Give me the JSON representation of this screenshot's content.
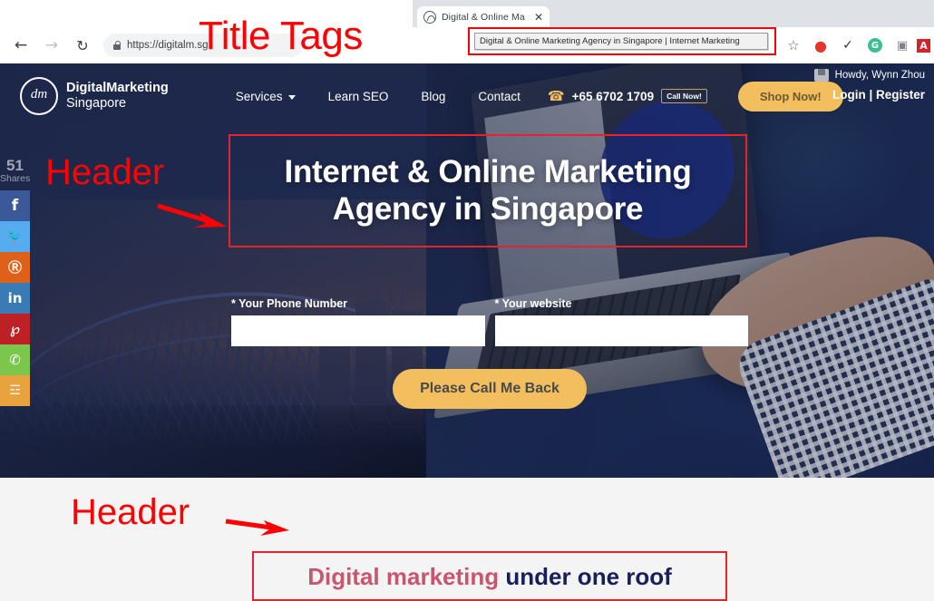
{
  "browser": {
    "tab": {
      "title": "Digital & Online Ma",
      "close_label": "✕",
      "favicon": "site-favicon"
    },
    "back_label": "←",
    "forward_label": "→",
    "reload_label": "↻",
    "url": "https://digitalm.sg",
    "title_tooltip": "Digital & Online Marketing Agency in Singapore | Internet Marketing",
    "toolbar_icons": [
      {
        "name": "bookmark-star-icon",
        "glyph": "☆",
        "color": "#5f6368"
      },
      {
        "name": "opera-extension-icon",
        "glyph": "●",
        "color": "#e2372b"
      },
      {
        "name": "check-mark-extension-icon",
        "glyph": "✓",
        "color": "#2c3038"
      },
      {
        "name": "grammarly-extension-icon",
        "glyph": "G",
        "color": "#3ebd93"
      },
      {
        "name": "screenshot-camera-icon",
        "glyph": "▣",
        "color": "#7d838c"
      },
      {
        "name": "adobe-acrobat-icon",
        "glyph": "A",
        "color": "#d0232b"
      }
    ]
  },
  "annotations": {
    "title_tags": "Title Tags",
    "header_hero": "Header",
    "header_lower": "Header",
    "box_color": "#e8212a",
    "text_color": "#ff0000"
  },
  "site": {
    "logo": {
      "line1": "DigitalMarketing",
      "line2": "Singapore",
      "mark": "dm-monogram-icon"
    },
    "nav": [
      {
        "label": "Services",
        "has_caret": true
      },
      {
        "label": "Learn SEO",
        "has_caret": false
      },
      {
        "label": "Blog",
        "has_caret": false
      },
      {
        "label": "Contact",
        "has_caret": false
      }
    ],
    "phone": {
      "number": "+65 6702 1709",
      "badge": "Call Now!",
      "icon": "phone-icon"
    },
    "shop_now": "Shop Now!",
    "account": {
      "howdy": "Howdy, Wynn Zhou",
      "links": "Login | Register",
      "avatar": "user-avatar-icon"
    },
    "hero": {
      "headline": "Internet & Online Marketing Agency in Singapore",
      "form": {
        "phone_label": "* Your Phone Number",
        "phone_value": "",
        "phone_placeholder": "",
        "website_label": "* Your website",
        "website_value": "",
        "website_placeholder": "",
        "cta": "Please Call Me Back"
      }
    },
    "share": {
      "count": "51",
      "count_label": "Shares",
      "buttons": [
        {
          "name": "facebook-icon",
          "glyph": "f",
          "color": "#3b5998"
        },
        {
          "name": "twitter-icon",
          "glyph": "🐦",
          "color": "#55acee"
        },
        {
          "name": "reddit-icon",
          "glyph": "Ⓡ",
          "color": "#dd6118"
        },
        {
          "name": "linkedin-icon",
          "glyph": "in",
          "color": "#3b7bb5"
        },
        {
          "name": "pinterest-icon",
          "glyph": "℘",
          "color": "#bd2025"
        },
        {
          "name": "whatsapp-icon",
          "glyph": "✆",
          "color": "#7bc74d"
        },
        {
          "name": "share-more-icon",
          "glyph": "☲",
          "color": "#e8a33d"
        }
      ]
    },
    "subheading": {
      "part1": "Digital marketing ",
      "part2": "under one roof"
    }
  },
  "colors": {
    "nav_bg": "#1f2a4f",
    "accent_gold": "#f3bf5e",
    "lower_bg": "#f4f4f4",
    "subhead_pink": "#c9556f",
    "subhead_navy": "#17205a"
  }
}
